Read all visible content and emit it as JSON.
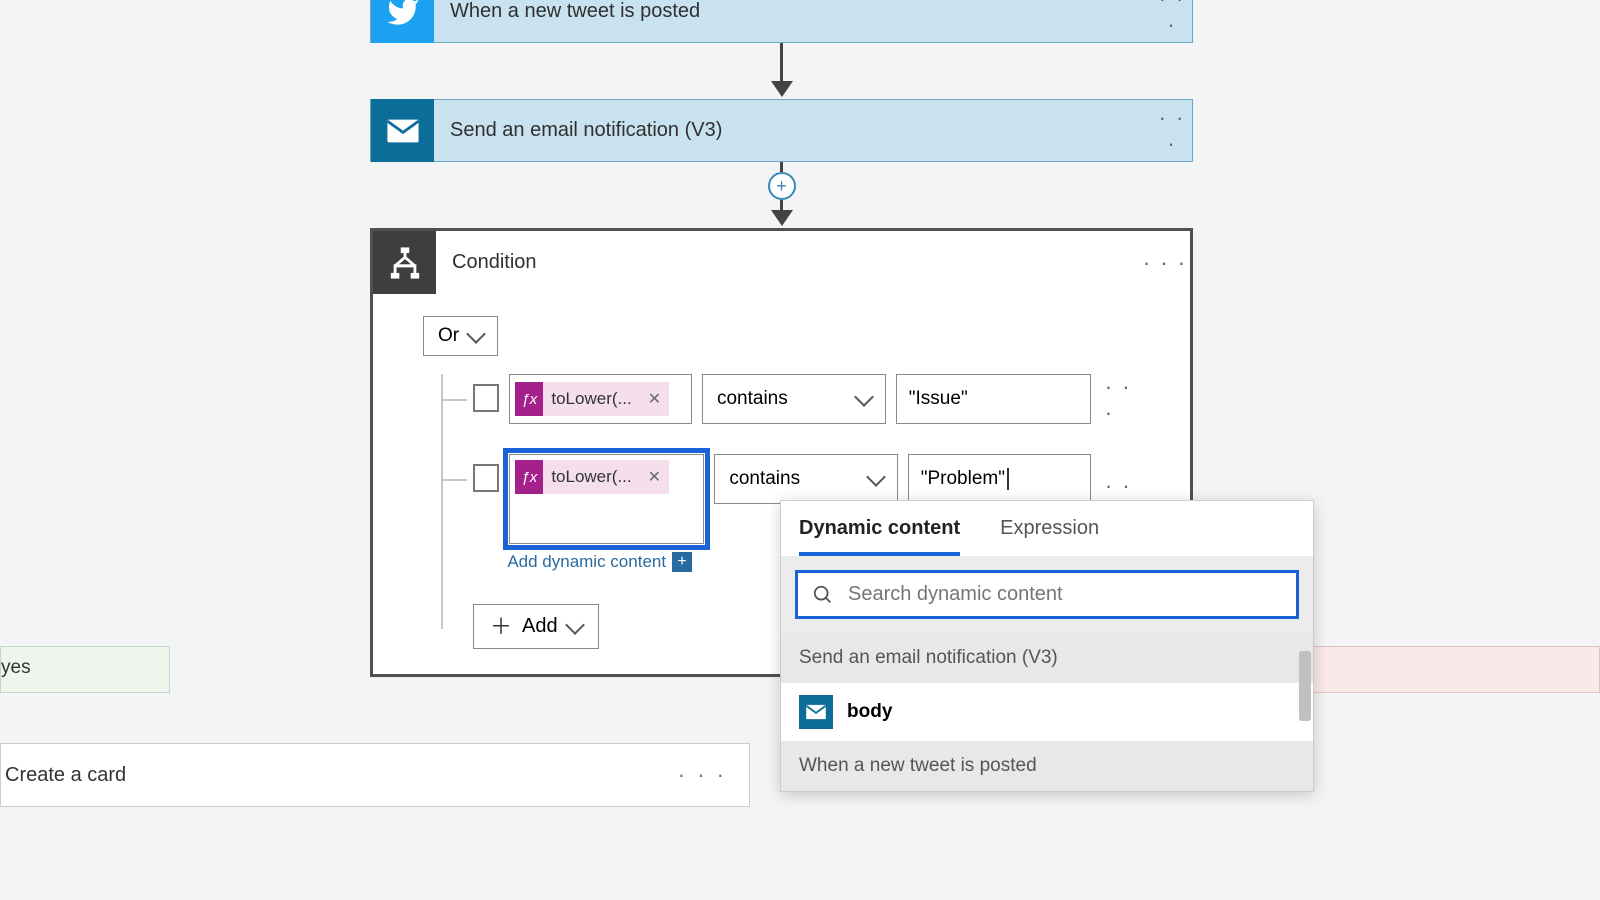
{
  "steps": {
    "trigger": {
      "title": "When a new tweet is posted"
    },
    "action1": {
      "title": "Send an email notification (V3)"
    },
    "condition": {
      "title": "Condition"
    }
  },
  "condition": {
    "logic": "Or",
    "add_label": "Add",
    "add_dynamic_label": "Add dynamic content",
    "rows": [
      {
        "token": "toLower(...",
        "operator": "contains",
        "value": "\"Issue\""
      },
      {
        "token": "toLower(...",
        "operator": "contains",
        "value": "\"Problem\""
      }
    ]
  },
  "branches": {
    "yes_label": "yes",
    "create_card_label": "Create a card"
  },
  "dynamic_content": {
    "tab_dynamic": "Dynamic content",
    "tab_expression": "Expression",
    "search_placeholder": "Search dynamic content",
    "section1": "Send an email notification (V3)",
    "item1": "body",
    "section2": "When a new tweet is posted"
  }
}
